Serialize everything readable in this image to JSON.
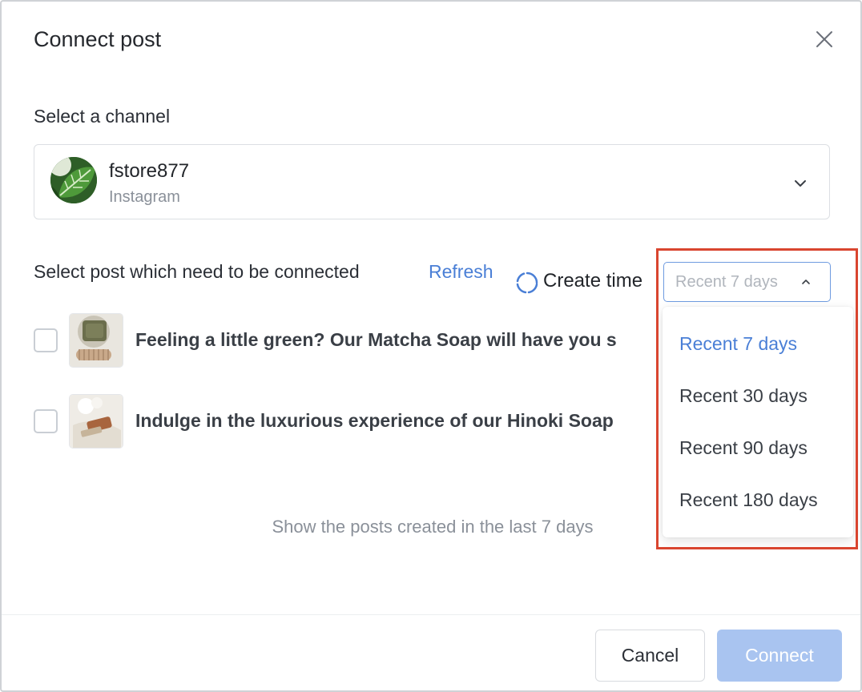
{
  "dialog": {
    "title": "Connect post",
    "close_icon": "close-icon"
  },
  "channel": {
    "label": "Select a channel",
    "name": "fstore877",
    "platform": "Instagram",
    "chevron_icon": "chevron-down-icon"
  },
  "posts": {
    "label": "Select post which need to be connected",
    "refresh": "Refresh",
    "create_time_label": "Create time",
    "items": [
      {
        "text": "Feeling a little green? Our Matcha Soap will have you s",
        "checked": false
      },
      {
        "text": "Indulge in the luxurious experience of our Hinoki Soap",
        "checked": false
      }
    ],
    "hint": "Show the posts created in the last 7 days"
  },
  "time_filter": {
    "selected": "Recent 7 days",
    "options": [
      "Recent 7 days",
      "Recent 30 days",
      "Recent 90 days",
      "Recent 180 days"
    ],
    "accent_color": "#4a7fd6"
  },
  "footer": {
    "cancel": "Cancel",
    "connect": "Connect"
  },
  "colors": {
    "accent": "#4a7fd6",
    "connect_disabled": "#a9c4f0",
    "highlight": "#d9452f"
  }
}
